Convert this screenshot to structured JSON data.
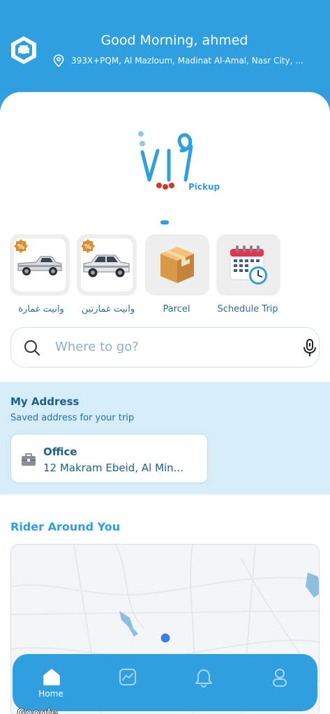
{
  "header": {
    "greeting": "Good Morning, ahmed",
    "location": "393X+PQM, Al Mazloum, Madinat Al-Amal, Nasr City, ...",
    "icons": [
      "car-badge-icon",
      "location-pin-icon"
    ]
  },
  "logo": {
    "tagline": "Pickup"
  },
  "services": [
    {
      "label": "وانيت غمارة",
      "icon": "pickup-truck-single-cab"
    },
    {
      "label": "وانيت غمارتين",
      "icon": "pickup-truck-double-cab"
    },
    {
      "label": "Parcel",
      "icon": "box-icon"
    },
    {
      "label": "Schedule Trip",
      "icon": "calendar-clock-icon"
    }
  ],
  "search": {
    "placeholder": "Where to go?"
  },
  "address": {
    "title": "My Address",
    "subtitle": "Saved address for your trip",
    "saved": {
      "name": "Office",
      "line": "12 Makram Ebeid, Al Min..."
    }
  },
  "riders": {
    "title": "Rider Around You"
  },
  "nav": {
    "home_label": "Home",
    "items": [
      "home-icon",
      "activity-icon",
      "bell-icon",
      "profile-icon"
    ]
  },
  "map_attribution": "Google",
  "colors": {
    "primary": "#2f9fdf",
    "text_dark": "#1f5f86",
    "address_bg": "#d5ecf9"
  }
}
